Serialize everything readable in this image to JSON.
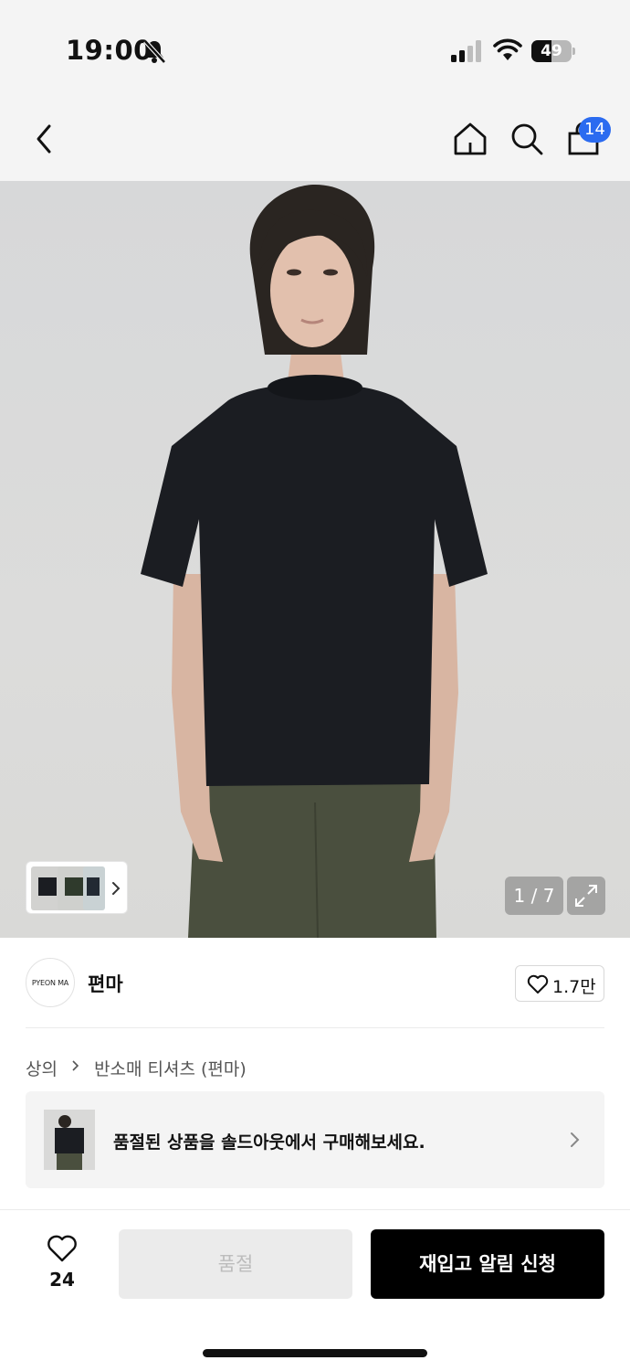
{
  "status_bar": {
    "time": "19:00",
    "battery_level": "49",
    "battery_fraction": 0.49,
    "icons": [
      "bell-slash-icon",
      "cellular-signal-icon",
      "wifi-icon",
      "battery-icon"
    ]
  },
  "nav": {
    "icons": [
      "chevron-left-icon",
      "home-icon",
      "search-icon",
      "shopping-bag-icon"
    ],
    "cart_badge": "14"
  },
  "gallery": {
    "counter": "1 / 7",
    "icons": [
      "expand-icon",
      "chevron-right-icon"
    ]
  },
  "brand": {
    "logo_text": "PYEON MA",
    "name": "편마",
    "like_count": "1.7만"
  },
  "breadcrumb": {
    "category": "상의",
    "subcategory": "반소매 티셔츠 (편마)"
  },
  "soldout_banner": {
    "text": "품절된 상품을 솔드아웃에서 구매해보세요."
  },
  "bottom_bar": {
    "wish_count": "24",
    "soldout_label": "품절",
    "restock_label": "재입고 알림 신청"
  },
  "colors": {
    "badge": "#2b6bf0",
    "primary_button": "#000000",
    "disabled_button": "#ebebeb",
    "shirt": "#1b1d22",
    "pants": "#4a4f3e"
  }
}
